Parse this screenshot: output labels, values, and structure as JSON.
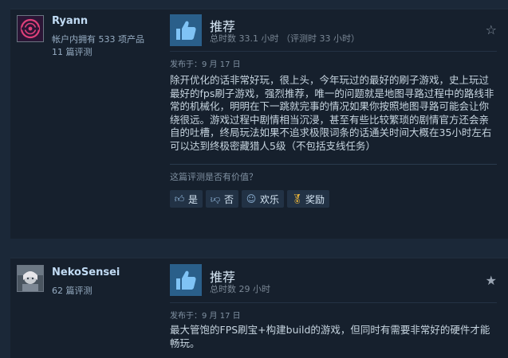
{
  "reviews": [
    {
      "user": {
        "name": "Ryann",
        "products": "帐户内拥有 533 项产品",
        "reviews": "11 篇评测"
      },
      "verdict": "推荐",
      "hours": "总时数 33.1 小时 （评测时 33 小时）",
      "posted": "发布于：9 月 17 日",
      "body": "除开优化的话非常好玩，很上头，今年玩过的最好的刷子游戏，史上玩过最好的fps刷子游戏，强烈推荐，唯一的问题就是地图寻路过程中的路线非常的机械化，明明在下一跳就完事的情况如果你按照地图寻路可能会让你绕很远。游戏过程中剧情相当沉浸，甚至有些比较繁琐的剧情官方还会亲自的吐槽，终局玩法如果不追求极限词条的话通关时间大概在35小时左右可以达到终极密藏猎人5级（不包括支线任务）",
      "helpful_question": "这篇评测是否有价值？",
      "buttons": {
        "yes": "是",
        "no": "否",
        "funny": "欢乐",
        "award": "奖励"
      }
    },
    {
      "user": {
        "name": "NekoSensei",
        "reviews": "62 篇评测"
      },
      "verdict": "推荐",
      "hours": "总时数 29 小时",
      "posted": "发布于：9 月 17 日",
      "body": "最大管饱的FPS刷宝+构建build的游戏，但同时有需要非常好的硬件才能畅玩。"
    }
  ],
  "icons": {
    "thumbs_up": "thumbs-up-icon",
    "star": "star-icon"
  },
  "colors": {
    "background": "#1b2838",
    "card": "#16202d",
    "thumb_box": "#2a5f8a",
    "username": "#c1dbf4"
  }
}
